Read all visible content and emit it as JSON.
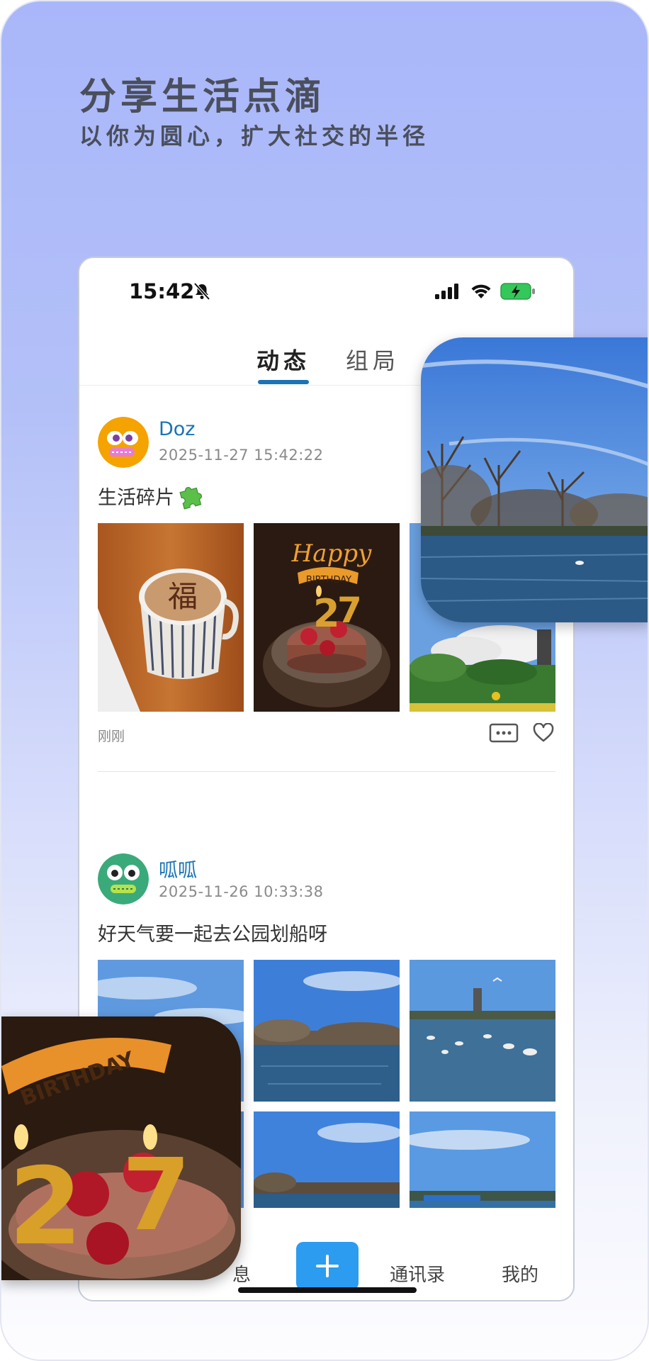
{
  "promo": {
    "headline": "分享生活点滴",
    "subheadline": "以你为圆心，扩大社交的半径"
  },
  "status_bar": {
    "time": "15:42",
    "icons": [
      "bell-muted-icon",
      "signal-icon",
      "wifi-icon",
      "battery-charging-icon"
    ]
  },
  "tabs": [
    {
      "label": "动态",
      "active": true
    },
    {
      "label": "组局",
      "active": false
    }
  ],
  "posts": [
    {
      "username": "Doz",
      "timestamp": "2025-11-27 15:42:22",
      "text": "生活碎片",
      "emoji_icon": "puzzle-piece-icon",
      "relative_time": "刚刚",
      "photos": [
        "latte-art-photo",
        "birthday-cake-photo",
        "sky-park-photo"
      ]
    },
    {
      "username": "呱呱",
      "timestamp": "2025-11-26 10:33:38",
      "text": "好天气要一起去公园划船呀",
      "photos": [
        "sky-lake-photo",
        "lake-trees-photo",
        "lake-birds-photo",
        "sky-lake-photo-2",
        "lake-sky-photo-3",
        "lake-sky-photo-4"
      ]
    }
  ],
  "bottom_nav": {
    "messages_partial": "息",
    "add_label": "+",
    "contacts": "通讯录",
    "me": "我的"
  },
  "colors": {
    "accent": "#1a73b5",
    "add_button": "#2b9cf0",
    "gradient_top": "#a9b7fa",
    "battery_green": "#34c759"
  }
}
